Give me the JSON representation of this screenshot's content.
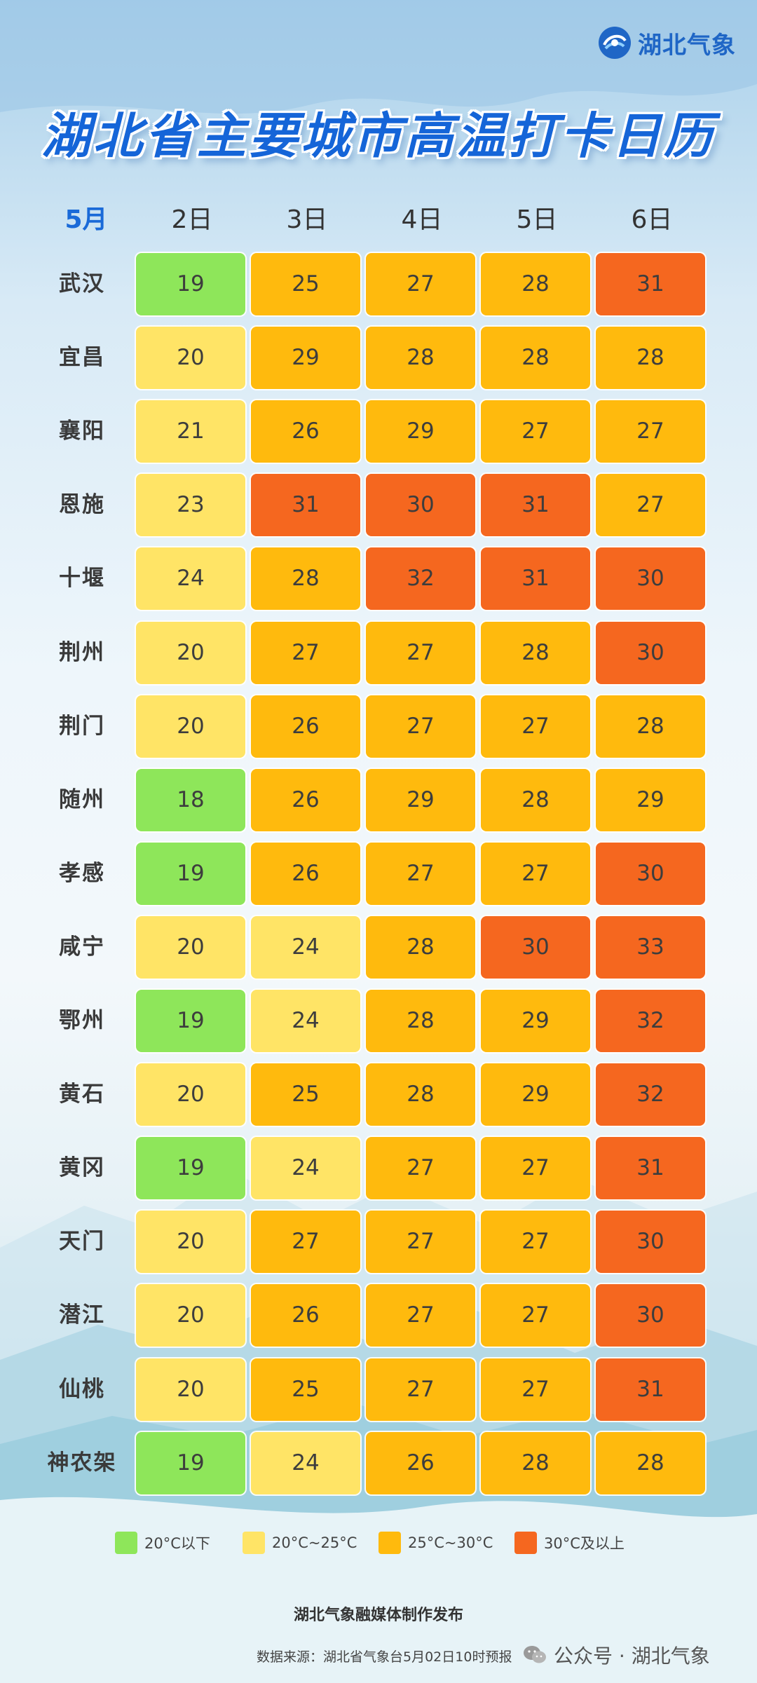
{
  "brand": {
    "name": "湖北气象"
  },
  "title": "湖北省主要城市高温打卡日历",
  "chart_data": {
    "type": "table",
    "month_label": "5月",
    "columns": [
      "2日",
      "3日",
      "4日",
      "5日",
      "6日"
    ],
    "rows": [
      {
        "city": "武汉",
        "values": [
          19,
          25,
          27,
          28,
          31
        ]
      },
      {
        "city": "宜昌",
        "values": [
          20,
          29,
          28,
          28,
          28
        ]
      },
      {
        "city": "襄阳",
        "values": [
          21,
          26,
          29,
          27,
          27
        ]
      },
      {
        "city": "恩施",
        "values": [
          23,
          31,
          30,
          31,
          27
        ]
      },
      {
        "city": "十堰",
        "values": [
          24,
          28,
          32,
          31,
          30
        ]
      },
      {
        "city": "荆州",
        "values": [
          20,
          27,
          27,
          28,
          30
        ]
      },
      {
        "city": "荆门",
        "values": [
          20,
          26,
          27,
          27,
          28
        ]
      },
      {
        "city": "随州",
        "values": [
          18,
          26,
          29,
          28,
          29
        ]
      },
      {
        "city": "孝感",
        "values": [
          19,
          26,
          27,
          27,
          30
        ]
      },
      {
        "city": "咸宁",
        "values": [
          20,
          24,
          28,
          30,
          33
        ]
      },
      {
        "city": "鄂州",
        "values": [
          19,
          24,
          28,
          29,
          32
        ]
      },
      {
        "city": "黄石",
        "values": [
          20,
          25,
          28,
          29,
          32
        ]
      },
      {
        "city": "黄冈",
        "values": [
          19,
          24,
          27,
          27,
          31
        ]
      },
      {
        "city": "天门",
        "values": [
          20,
          27,
          27,
          27,
          30
        ]
      },
      {
        "city": "潜江",
        "values": [
          20,
          26,
          27,
          27,
          30
        ]
      },
      {
        "city": "仙桃",
        "values": [
          20,
          25,
          27,
          27,
          31
        ]
      },
      {
        "city": "神农架",
        "values": [
          19,
          24,
          26,
          28,
          28
        ]
      }
    ],
    "legend": [
      {
        "label": "20°C以下",
        "color": "#8ee65a"
      },
      {
        "label": "20°C~25°C",
        "color": "#ffe466"
      },
      {
        "label": "25°C~30°C",
        "color": "#ffba0d"
      },
      {
        "label": "30°C及以上",
        "color": "#f5671f"
      }
    ]
  },
  "footer": {
    "publisher": "湖北气象融媒体制作发布",
    "source": "数据来源：湖北省气象台5月02日10时预报",
    "wechat": "公众号 · 湖北气象"
  }
}
